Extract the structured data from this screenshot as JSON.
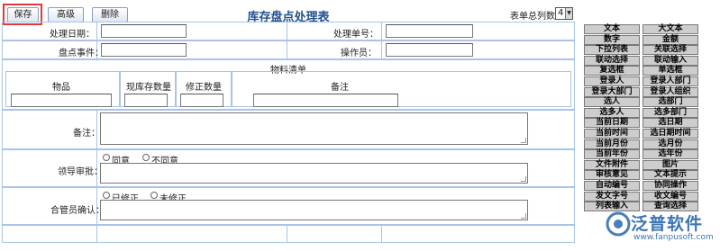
{
  "toolbar": {
    "save_label": "保存",
    "advanced_label": "高级",
    "delete_label": "删除"
  },
  "form_title": "库存盘点处理表",
  "column_count": {
    "label": "表单总列数：",
    "value": "4"
  },
  "fields": {
    "process_date_label": "处理日期：",
    "process_number_label": "处理单号：",
    "inventory_event_label": "盘点事件：",
    "operator_label": "操作员："
  },
  "material_list": {
    "title": "物料清单",
    "headers": [
      "物品",
      "现库存数量",
      "修正数量",
      "备注"
    ]
  },
  "remarks_label": "备注：",
  "leader_approval": {
    "label": "领导审批：",
    "options": [
      "同意",
      "不同意"
    ]
  },
  "warehouse_confirm": {
    "label": "合管员确认：",
    "options": [
      "已修正",
      "未修正"
    ]
  },
  "side_palette": [
    [
      "文本",
      "大文本"
    ],
    [
      "数字",
      "金额"
    ],
    [
      "下拉列表",
      "关联选择"
    ],
    [
      "联动选择",
      "联动输入"
    ],
    [
      "复选框",
      "单选框"
    ],
    [
      "登录人",
      "登录人部门"
    ],
    [
      "登录大部门",
      "登录人组织"
    ],
    [
      "选人",
      "选部门"
    ],
    [
      "选多人",
      "选多部门"
    ],
    [
      "当前日期",
      "选日期"
    ],
    [
      "当前时间",
      "选日期时间"
    ],
    [
      "当前月份",
      "选月份"
    ],
    [
      "当前年份",
      "选年份"
    ],
    [
      "文件附件",
      "图片"
    ],
    [
      "审核意见",
      "文本提示"
    ],
    [
      "自动编号",
      "协同操作"
    ],
    [
      "发文字号",
      "收文编号"
    ],
    [
      "列表输入",
      "查询选择"
    ]
  ],
  "logo": {
    "text": "泛普软件",
    "url": "www.fanpusoft.com"
  }
}
